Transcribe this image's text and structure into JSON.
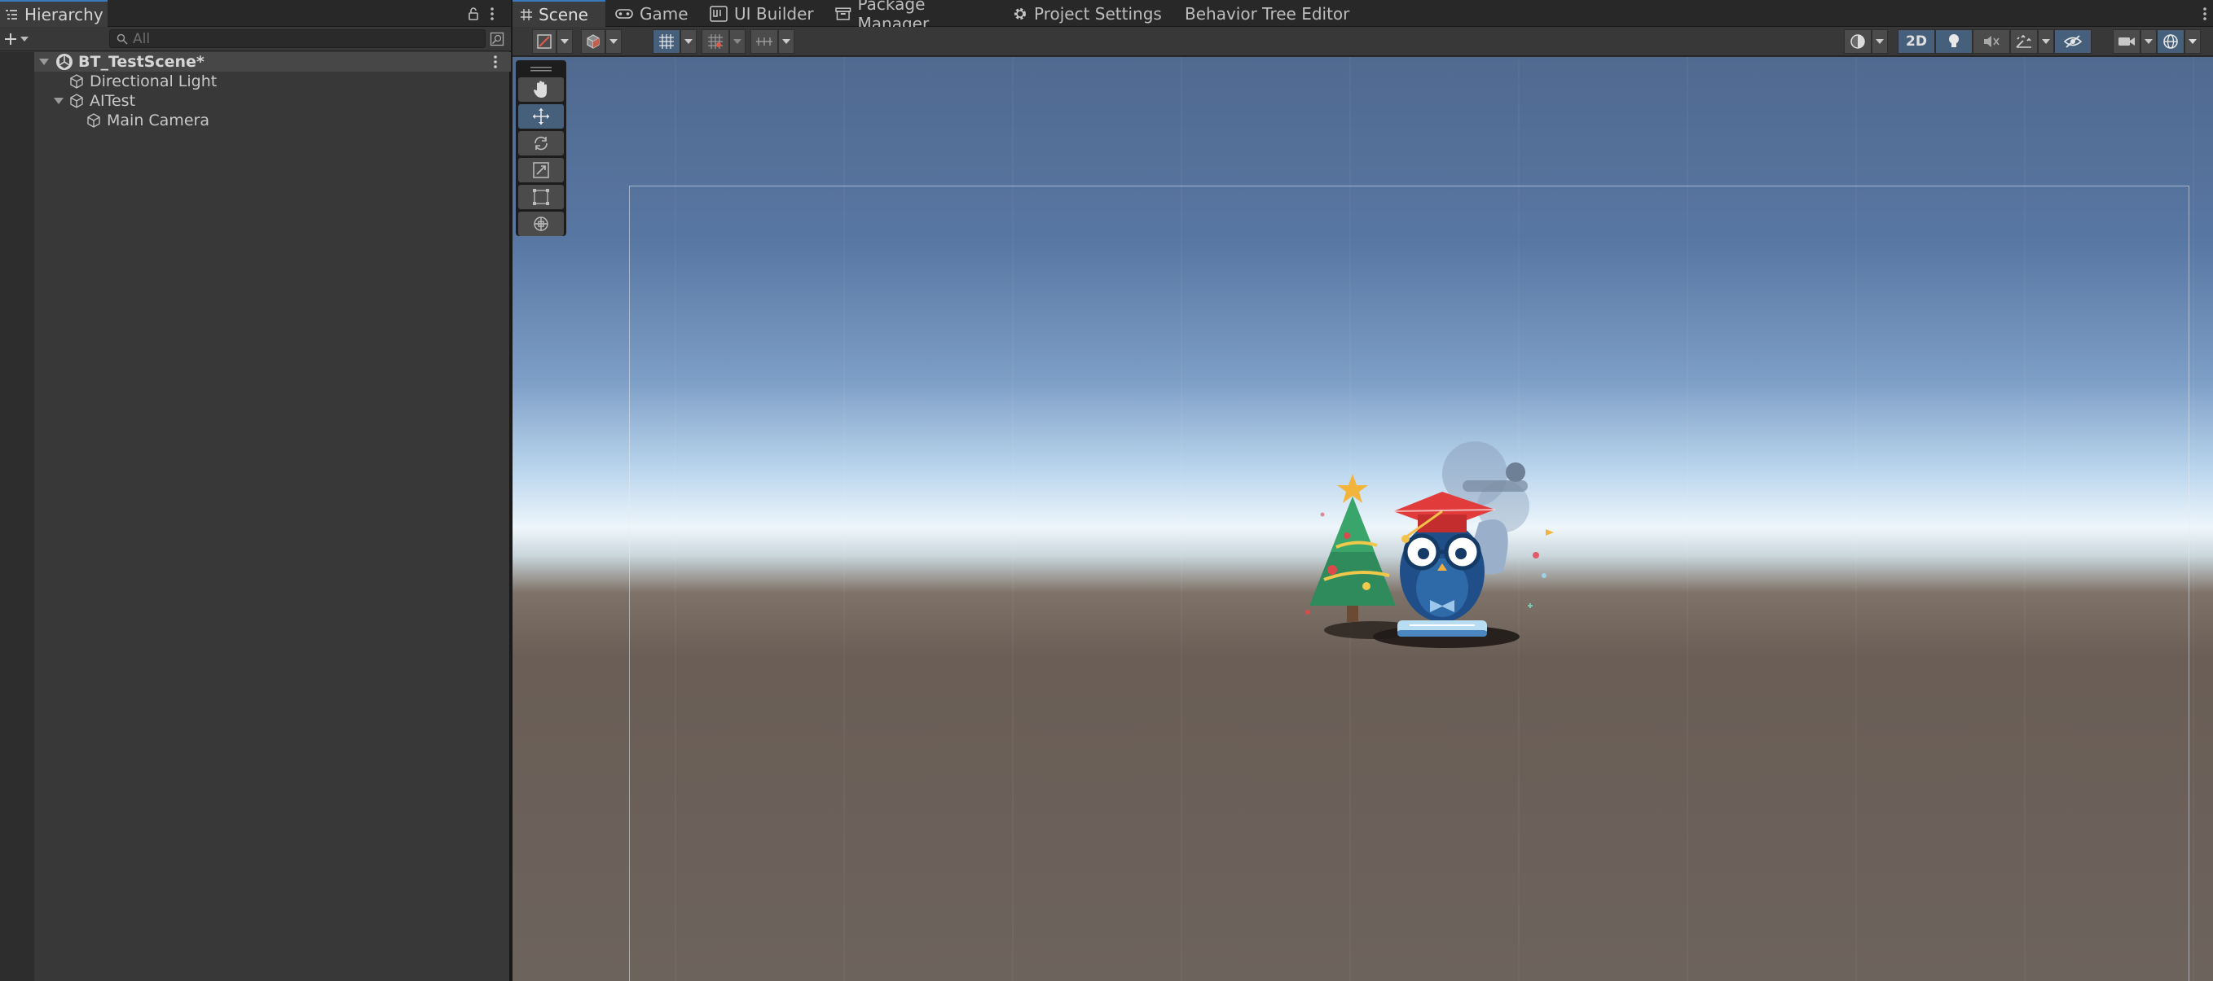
{
  "hierarchy": {
    "tab_label": "Hierarchy",
    "search_placeholder": "All",
    "scene_name": "BT_TestScene*",
    "objects": [
      {
        "label": "Directional Light",
        "depth": 1
      },
      {
        "label": "AITest",
        "depth": 1,
        "expanded": true
      },
      {
        "label": "Main Camera",
        "depth": 2
      }
    ]
  },
  "main": {
    "tabs": [
      {
        "label": "Scene",
        "icon": "grid-icon",
        "active": true
      },
      {
        "label": "Game",
        "icon": "gamepad-icon"
      },
      {
        "label": "UI Builder",
        "icon": "ui-builder-icon"
      },
      {
        "label": "Package Manager",
        "icon": "package-icon"
      },
      {
        "label": "Project Settings",
        "icon": "gear-icon"
      },
      {
        "label": "Behavior Tree Editor",
        "icon": ""
      }
    ],
    "toolbar": {
      "toggle_2d": "2D"
    },
    "tools": [
      "hand-tool",
      "move-tool",
      "rotate-tool",
      "scale-tool",
      "rect-tool",
      "transform-tool"
    ],
    "active_tool": "move-tool"
  },
  "colors": {
    "accent": "#3a79bb",
    "active_button": "#46607c",
    "panel": "#383838",
    "tabbar": "#282828"
  }
}
